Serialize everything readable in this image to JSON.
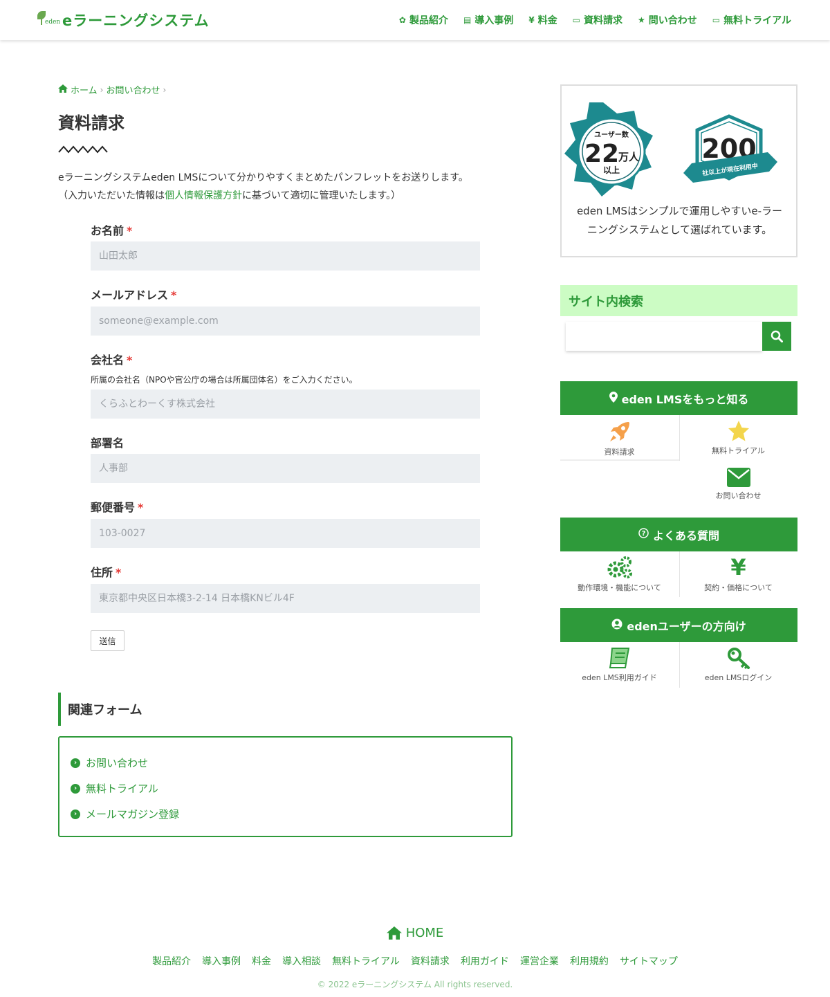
{
  "header": {
    "logo_small": "eden",
    "logo_text": "eラーニングシステム",
    "nav": [
      {
        "label": "製品紹介",
        "icon": "gear-icon"
      },
      {
        "label": "導入事例",
        "icon": "building-icon"
      },
      {
        "label": "料金",
        "icon": "yen-icon"
      },
      {
        "label": "資料請求",
        "icon": "id-card-icon"
      },
      {
        "label": "問い合わせ",
        "icon": "star-icon"
      },
      {
        "label": "無料トライアル",
        "icon": "id-card-icon"
      }
    ]
  },
  "breadcrumb": {
    "home": "ホーム",
    "current": "お問い合わせ"
  },
  "page": {
    "title": "資料請求",
    "intro_line1": "eラーニングシステムeden LMSについて分かりやすくまとめたパンフレットをお送りします。",
    "intro_line2_a": "（入力いただいた情報は",
    "intro_line2_link": "個人情報保護方針",
    "intro_line2_b": "に基づいて適切に管理いたします。）"
  },
  "form": {
    "required_mark": "*",
    "fields": [
      {
        "label": "お名前",
        "placeholder": "山田太郎",
        "required": true
      },
      {
        "label": "メールアドレス",
        "placeholder": "someone@example.com",
        "required": true
      },
      {
        "label": "会社名",
        "placeholder": "くらふとわーくす株式会社",
        "required": true,
        "help": "所属の会社名（NPOや官公庁の場合は所属団体名）をご入力ください。"
      },
      {
        "label": "部署名",
        "placeholder": "人事部",
        "required": false
      },
      {
        "label": "郵便番号",
        "placeholder": "103-0027",
        "required": true
      },
      {
        "label": "住所",
        "placeholder": "東京都中央区日本橋3-2-14 日本橋KNビル4F",
        "required": true
      }
    ],
    "submit_label": "送信"
  },
  "related": {
    "title": "関連フォーム",
    "items": [
      "お問い合わせ",
      "無料トライアル",
      "メールマガジン登録"
    ]
  },
  "sidebar": {
    "badge1_top": "ユーザー数",
    "badge1_number": "22",
    "badge1_unit": "万人",
    "badge1_bottom": "以上",
    "badge2_number": "200",
    "badge2_ribbon": "社以上が現在利用中",
    "badge_caption": "eden LMSはシンプルで運用しやすいe-ラーニングシステムとして選ばれています。",
    "search_title": "サイト内検索",
    "widget1_title": "eden LMSをもっと知る",
    "widget1_tiles": [
      "資料請求",
      "無料トライアル",
      "お問い合わせ"
    ],
    "widget2_title": "よくある質問",
    "widget2_tiles": [
      "動作環境・機能について",
      "契約・価格について"
    ],
    "widget3_title": "edenユーザーの方向け",
    "widget3_tiles": [
      "eden LMS利用ガイド",
      "eden LMSログイン"
    ],
    "colors": {
      "accent": "#2e9a3a",
      "search_head_bg": "#ccfcc4"
    }
  },
  "footer": {
    "home": "HOME",
    "links": [
      "製品紹介",
      "導入事例",
      "料金",
      "導入相談",
      "無料トライアル",
      "資料請求",
      "利用ガイド",
      "運営企業",
      "利用規約",
      "サイトマップ"
    ],
    "copyright": "© 2022 eラーニングシステム All rights reserved."
  }
}
